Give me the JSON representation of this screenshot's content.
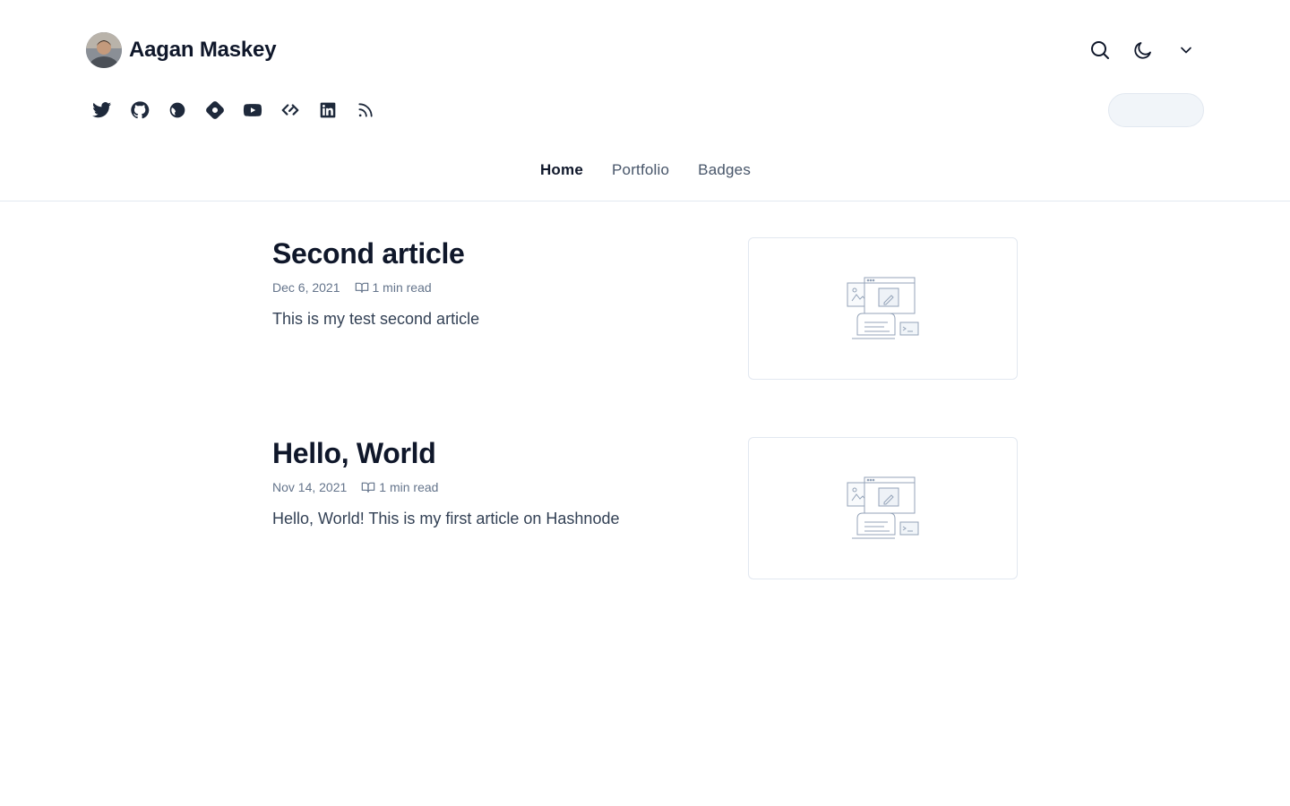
{
  "header": {
    "author_name": "Aagan Maskey",
    "actions": [
      {
        "name": "search-icon"
      },
      {
        "name": "moon-icon"
      },
      {
        "name": "chevron-down-icon"
      }
    ],
    "socials": [
      {
        "name": "twitter-icon"
      },
      {
        "name": "github-icon"
      },
      {
        "name": "globe-icon"
      },
      {
        "name": "hashnode-icon"
      },
      {
        "name": "youtube-icon"
      },
      {
        "name": "dailydev-icon"
      },
      {
        "name": "linkedin-icon"
      },
      {
        "name": "rss-icon"
      }
    ]
  },
  "nav": {
    "items": [
      {
        "label": "Home",
        "active": true
      },
      {
        "label": "Portfolio",
        "active": false
      },
      {
        "label": "Badges",
        "active": false
      }
    ]
  },
  "articles": [
    {
      "title": "Second article",
      "date": "Dec 6, 2021",
      "read_time": "1 min read",
      "brief": "This is my test second article"
    },
    {
      "title": "Hello, World",
      "date": "Nov 14, 2021",
      "read_time": "1 min read",
      "brief": "Hello, World! This is my first article on Hashnode"
    }
  ],
  "colors": {
    "text_primary": "#0f172a",
    "text_muted": "#64748b",
    "border": "#e2e8f0",
    "pill_bg": "#f1f5f9"
  }
}
